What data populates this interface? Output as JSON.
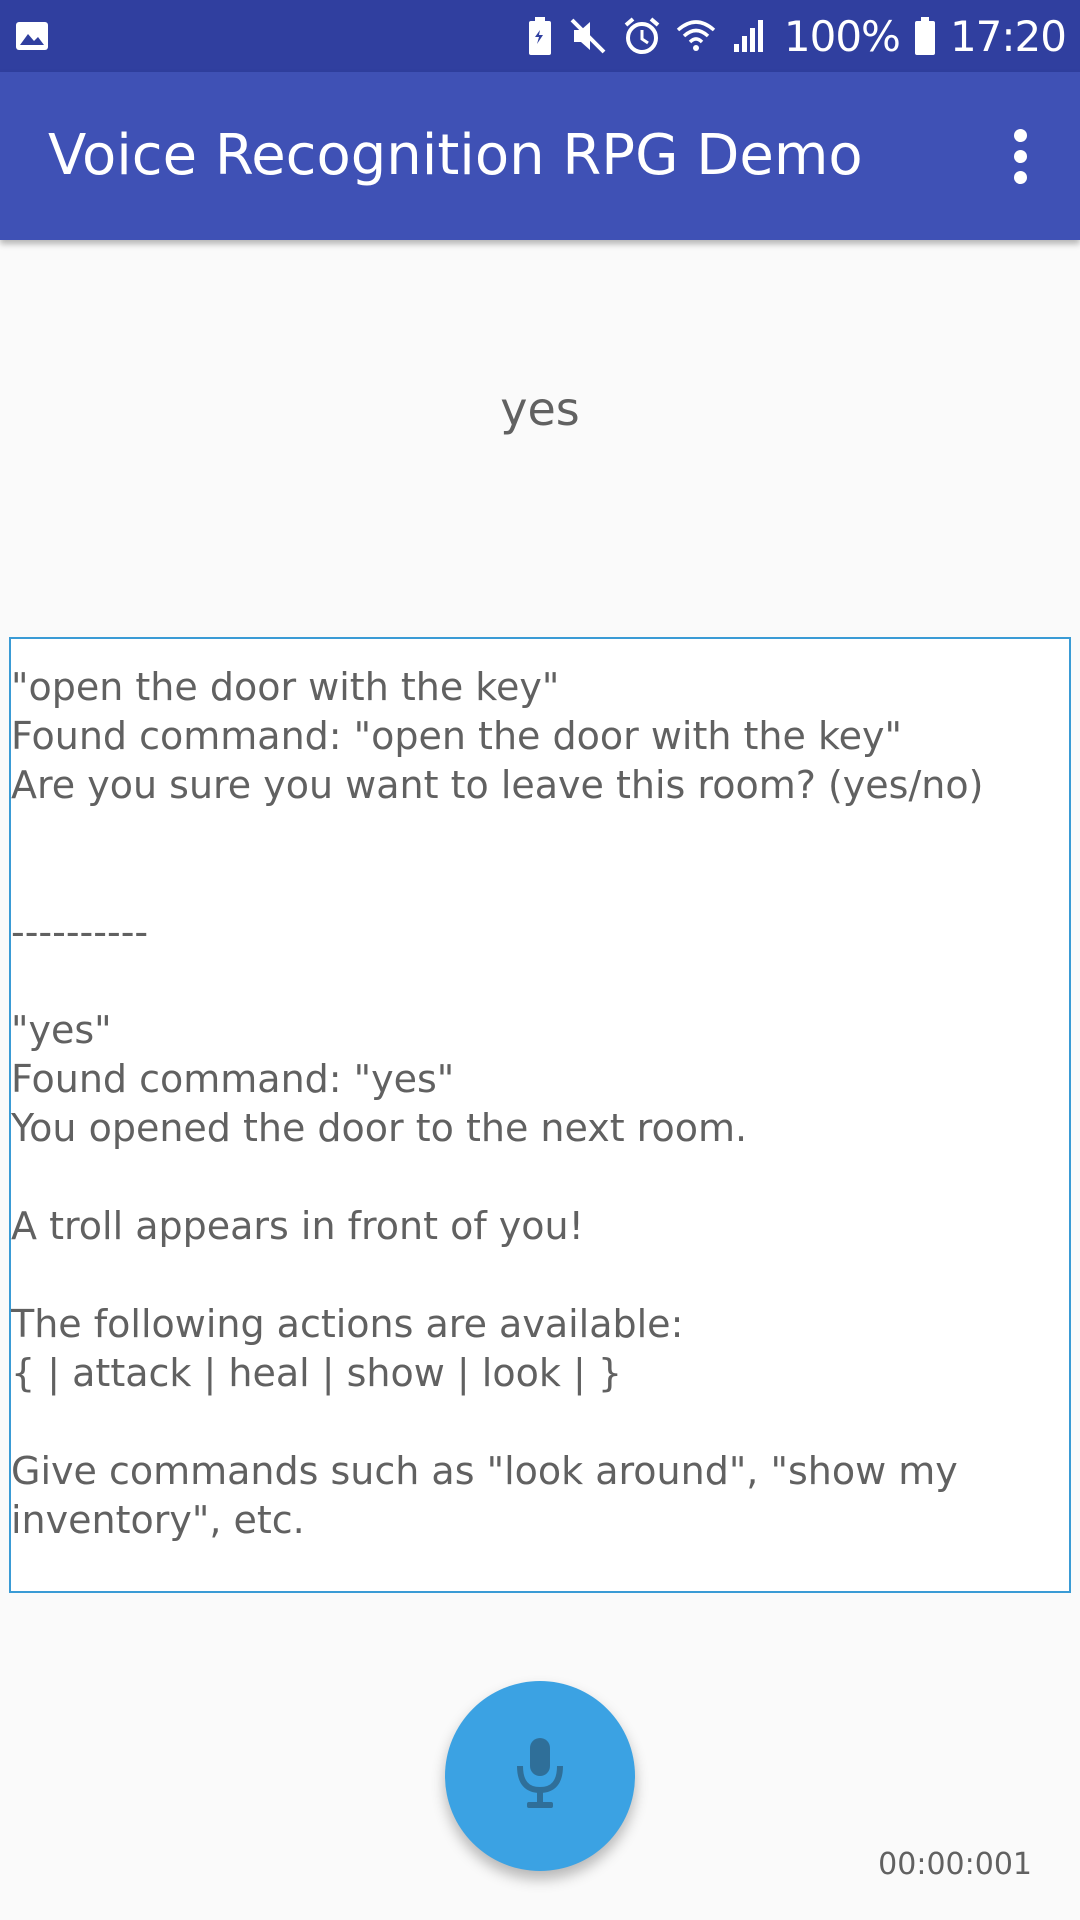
{
  "status_bar": {
    "battery_percent": "100%",
    "time": "17:20",
    "background_color": "#303f9f",
    "icons": [
      "image-icon",
      "battery-saver-icon",
      "mute-icon",
      "alarm-icon",
      "wifi-icon",
      "signal-icon",
      "battery-icon"
    ]
  },
  "app_bar": {
    "title": "Voice Recognition RPG Demo",
    "background_color": "#3f51b5",
    "overflow_icon": "more-vert-icon"
  },
  "recognized_text": "yes",
  "log": {
    "border_color": "#3a9bd5",
    "lines": [
      "\"open the door with the key\"",
      "Found command: \"open the door with the key\"",
      "Are you sure you want to leave this room? (yes/no)",
      "----------",
      "\"yes\"",
      "Found command: \"yes\"",
      "You opened the door to the next room.",
      "A troll appears in front of you!",
      "The following actions are available:",
      "{ | attack | heal | show | look | }",
      "Give commands such as \"look around\", \"show my",
      "inventory\", etc."
    ]
  },
  "mic_button": {
    "icon": "microphone-icon",
    "color": "#3ba2e3"
  },
  "timer": "00:00:001"
}
